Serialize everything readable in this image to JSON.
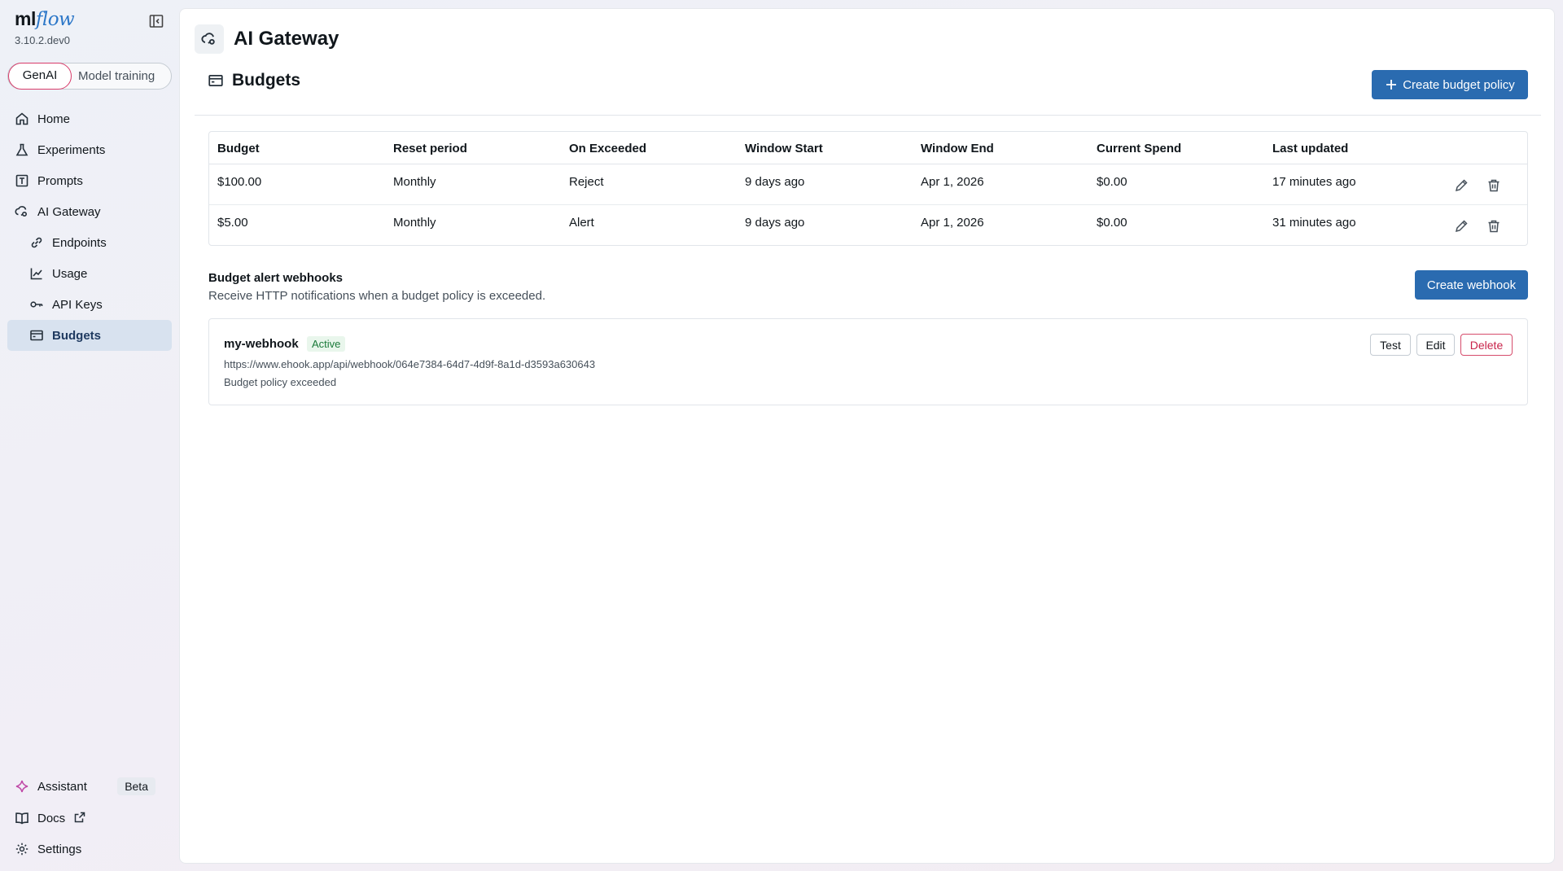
{
  "app": {
    "logo_prefix": "ml",
    "logo_suffix": "flow",
    "version": "3.10.2.dev0"
  },
  "mode_switch": {
    "options": [
      "GenAI",
      "Model training"
    ],
    "selected": "GenAI"
  },
  "sidebar": {
    "items": [
      {
        "label": "Home",
        "icon": "home-icon"
      },
      {
        "label": "Experiments",
        "icon": "beaker-icon"
      },
      {
        "label": "Prompts",
        "icon": "prompt-icon"
      },
      {
        "label": "AI Gateway",
        "icon": "gateway-icon"
      },
      {
        "label": "Endpoints",
        "icon": "link-icon"
      },
      {
        "label": "Usage",
        "icon": "chart-line-icon"
      },
      {
        "label": "API Keys",
        "icon": "key-icon"
      },
      {
        "label": "Budgets",
        "icon": "wallet-icon",
        "active": true
      }
    ],
    "bottom": [
      {
        "label": "Assistant",
        "icon": "sparkle-icon",
        "badge": "Beta"
      },
      {
        "label": "Docs",
        "icon": "book-icon"
      },
      {
        "label": "Settings",
        "icon": "gear-icon"
      }
    ]
  },
  "header": {
    "title": "AI Gateway"
  },
  "budgets": {
    "title": "Budgets",
    "create_label": "Create budget policy",
    "columns": [
      "Budget",
      "Reset period",
      "On Exceeded",
      "Window Start",
      "Window End",
      "Current Spend",
      "Last updated"
    ],
    "rows": [
      [
        "$100.00",
        "Monthly",
        "Reject",
        "9 days ago",
        "Apr 1, 2026",
        "$0.00",
        "17 minutes ago"
      ],
      [
        "$5.00",
        "Monthly",
        "Alert",
        "9 days ago",
        "Apr 1, 2026",
        "$0.00",
        "31 minutes ago"
      ]
    ]
  },
  "webhooks": {
    "title": "Budget alert webhooks",
    "description": "Receive HTTP notifications when a budget policy is exceeded.",
    "create_label": "Create webhook",
    "items": [
      {
        "name": "my-webhook",
        "status": "Active",
        "url": "https://www.ehook.app/api/webhook/064e7384-64d7-4d9f-8a1d-d3593a630643",
        "event": "Budget policy exceeded",
        "actions": [
          "Test",
          "Edit",
          "Delete"
        ]
      }
    ]
  },
  "colors": {
    "primary": "#2a6bb0",
    "danger": "#c8234a",
    "active_nav": "#d8e2ef",
    "status_active": "#1b7a3a"
  }
}
